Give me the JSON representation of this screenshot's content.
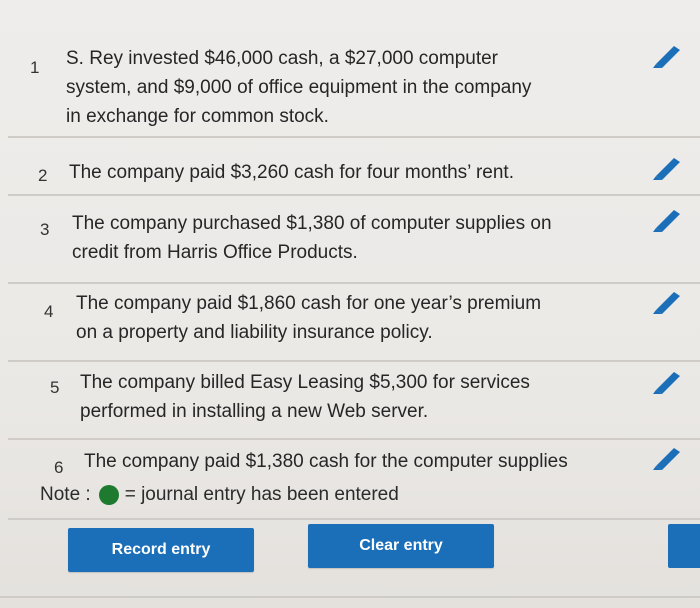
{
  "entries": [
    {
      "num": "1",
      "lines": [
        "S. Rey invested $46,000 cash, a $27,000 computer",
        "system, and $9,000 of office equipment in the company",
        "in exchange for common stock."
      ]
    },
    {
      "num": "2",
      "lines": [
        "The company paid $3,260 cash for four months’ rent."
      ]
    },
    {
      "num": "3",
      "lines": [
        "The company purchased $1,380 of computer supplies on",
        "credit from Harris Office Products."
      ]
    },
    {
      "num": "4",
      "lines": [
        "The company paid $1,860 cash for one year’s premium",
        "on a property and liability insurance policy."
      ]
    },
    {
      "num": "5",
      "lines": [
        "The company billed Easy Leasing $5,300 for services",
        "performed in installing a new Web server."
      ]
    },
    {
      "num": "6",
      "lines": [
        "The company paid $1,380 cash for the computer supplies"
      ]
    }
  ],
  "note": {
    "label": "Note :",
    "text": "= journal entry has been entered",
    "dot_color": "#1d7a2e"
  },
  "buttons": {
    "record": "Record entry",
    "clear": "Clear entry"
  },
  "icons": {
    "edit": "pencil-icon",
    "accent": "#1a6fb8"
  }
}
